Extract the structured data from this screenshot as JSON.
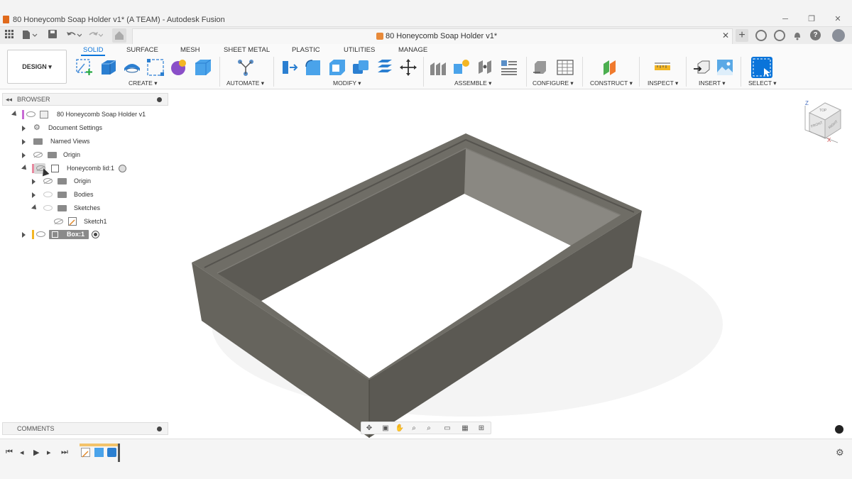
{
  "window": {
    "title": "80 Honeycomb Soap Holder v1* (A TEAM) - Autodesk Fusion",
    "minimize": "─",
    "restore": "❐",
    "close": "✕"
  },
  "document_tab": {
    "title": "80 Honeycomb Soap Holder v1*",
    "close": "✕"
  },
  "workspace": {
    "design_label": "DESIGN ▾"
  },
  "ribbon": {
    "tabs": [
      "SOLID",
      "SURFACE",
      "MESH",
      "SHEET METAL",
      "PLASTIC",
      "UTILITIES",
      "MANAGE"
    ],
    "active_tab": "SOLID",
    "groups": [
      "CREATE ▾",
      "AUTOMATE ▾",
      "MODIFY ▾",
      "ASSEMBLE ▾",
      "CONFIGURE ▾",
      "CONSTRUCT ▾",
      "INSPECT ▾",
      "INSERT ▾",
      "SELECT ▾"
    ]
  },
  "browser": {
    "header": "BROWSER",
    "items": [
      {
        "label": "80 Honeycomb Soap Holder v1"
      },
      {
        "label": "Document Settings"
      },
      {
        "label": "Named Views"
      },
      {
        "label": "Origin"
      },
      {
        "label": "Honeycomb lid:1"
      },
      {
        "label": "Origin"
      },
      {
        "label": "Bodies"
      },
      {
        "label": "Sketches"
      },
      {
        "label": "Sketch1"
      },
      {
        "label": "Box:1"
      }
    ]
  },
  "comments": {
    "header": "COMMENTS"
  },
  "viewcube": {
    "top": "TOP",
    "front": "FRONT",
    "right": "RIGHT",
    "axis_z": "Z",
    "axis_x": "X"
  },
  "colors": {
    "accent": "#0a74da",
    "model": "#6b6962",
    "selected_row": "#e3e3e3"
  },
  "icons": [
    "grid-menu-icon",
    "file-icon",
    "save-icon",
    "undo-icon",
    "redo-icon",
    "home-icon",
    "add-tab-icon",
    "extensions-icon",
    "job-status-icon",
    "notifications-icon",
    "help-icon",
    "avatar-icon"
  ]
}
